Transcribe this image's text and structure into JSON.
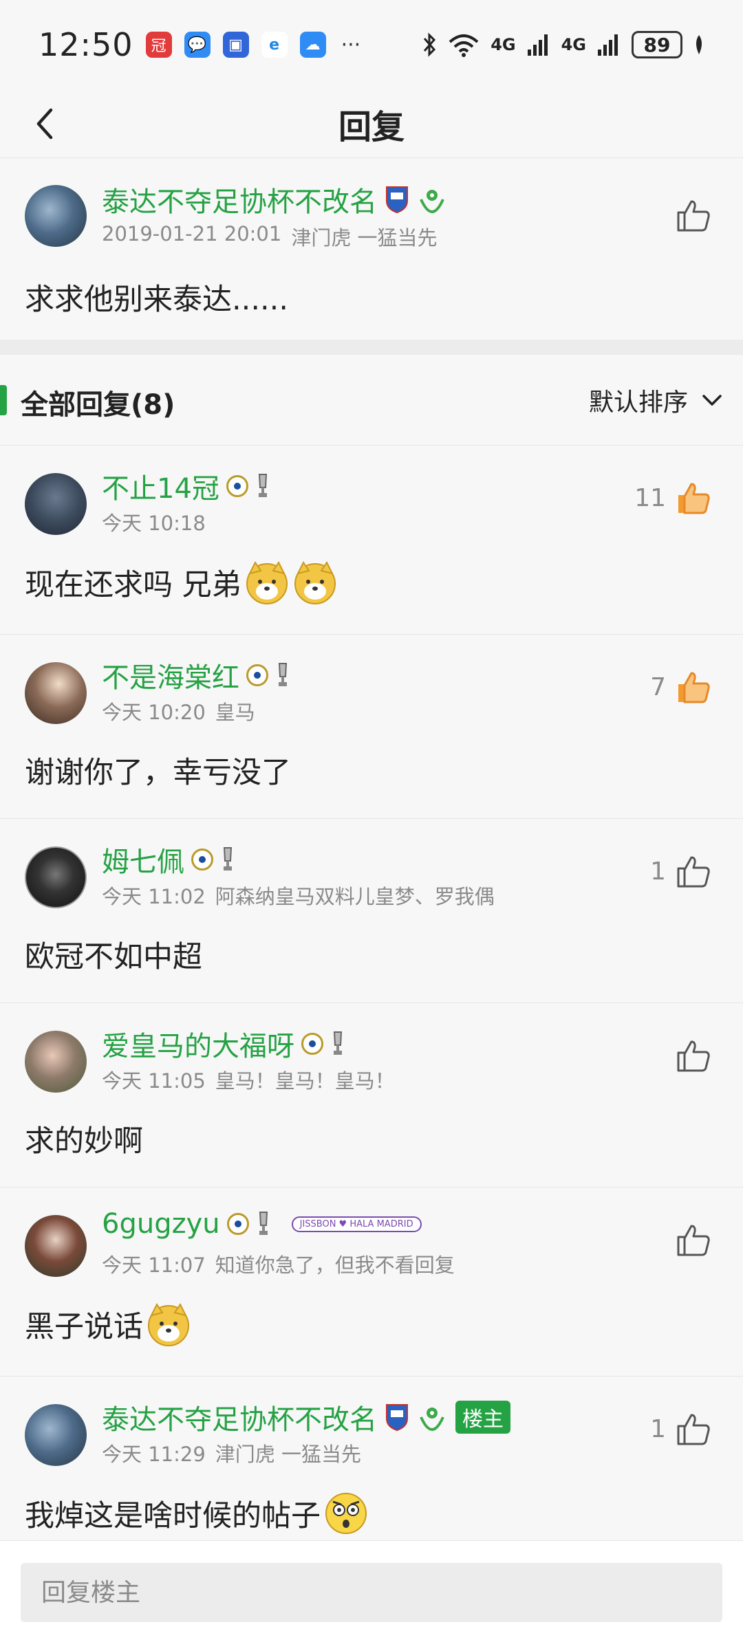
{
  "status_bar": {
    "time": "12:50",
    "battery": "89",
    "network_1": "4G",
    "network_2": "4G"
  },
  "nav": {
    "title": "回复",
    "back_icon": "chevron-left-icon"
  },
  "main_post": {
    "username": "泰达不夺足协杯不改名",
    "date": "2019-01-21 20:01",
    "signature": "津门虎 一猛当先",
    "text": "求求他别来泰达......"
  },
  "section": {
    "title": "全部回复(8)",
    "sort_label": "默认排序"
  },
  "replies": [
    {
      "username": "不止14冠",
      "time": "今天 10:18",
      "signature": "",
      "text": "现在还求吗 兄弟",
      "likes": "11",
      "liked": true,
      "emoji_count": 2
    },
    {
      "username": "不是海棠红",
      "time": "今天 10:20",
      "signature": "皇马",
      "text": "谢谢你了，幸亏没了",
      "likes": "7",
      "liked": true,
      "emoji_count": 0
    },
    {
      "username": "姆七佩",
      "time": "今天 11:02",
      "signature": "阿森纳皇马双料儿皇梦、罗我偶",
      "text": "欧冠不如中超",
      "likes": "1",
      "liked": false,
      "emoji_count": 0
    },
    {
      "username": "爱皇马的大福呀",
      "time": "今天 11:05",
      "signature": "皇马！皇马！皇马！",
      "text": "求的妙啊",
      "likes": "",
      "liked": false,
      "emoji_count": 0
    },
    {
      "username": "6gugzyu",
      "time": "今天 11:07",
      "signature": "知道你急了，但我不看回复",
      "text": "黑子说话",
      "likes": "",
      "liked": false,
      "emoji_count": 1,
      "tag": "JISSBON ♥ HALA MADRID"
    },
    {
      "username": "泰达不夺足协杯不改名",
      "time": "今天 11:29",
      "signature": "津门虎 一猛当先",
      "text": "我焯这是啥时候的帖子",
      "likes": "1",
      "liked": false,
      "emoji_count": 1,
      "owner_tag": "楼主"
    }
  ],
  "bottom": {
    "input_placeholder": "回复楼主"
  },
  "colors": {
    "accent": "#25a244",
    "like_active": "#f29a2e",
    "text_gray": "#8a8a8a"
  }
}
